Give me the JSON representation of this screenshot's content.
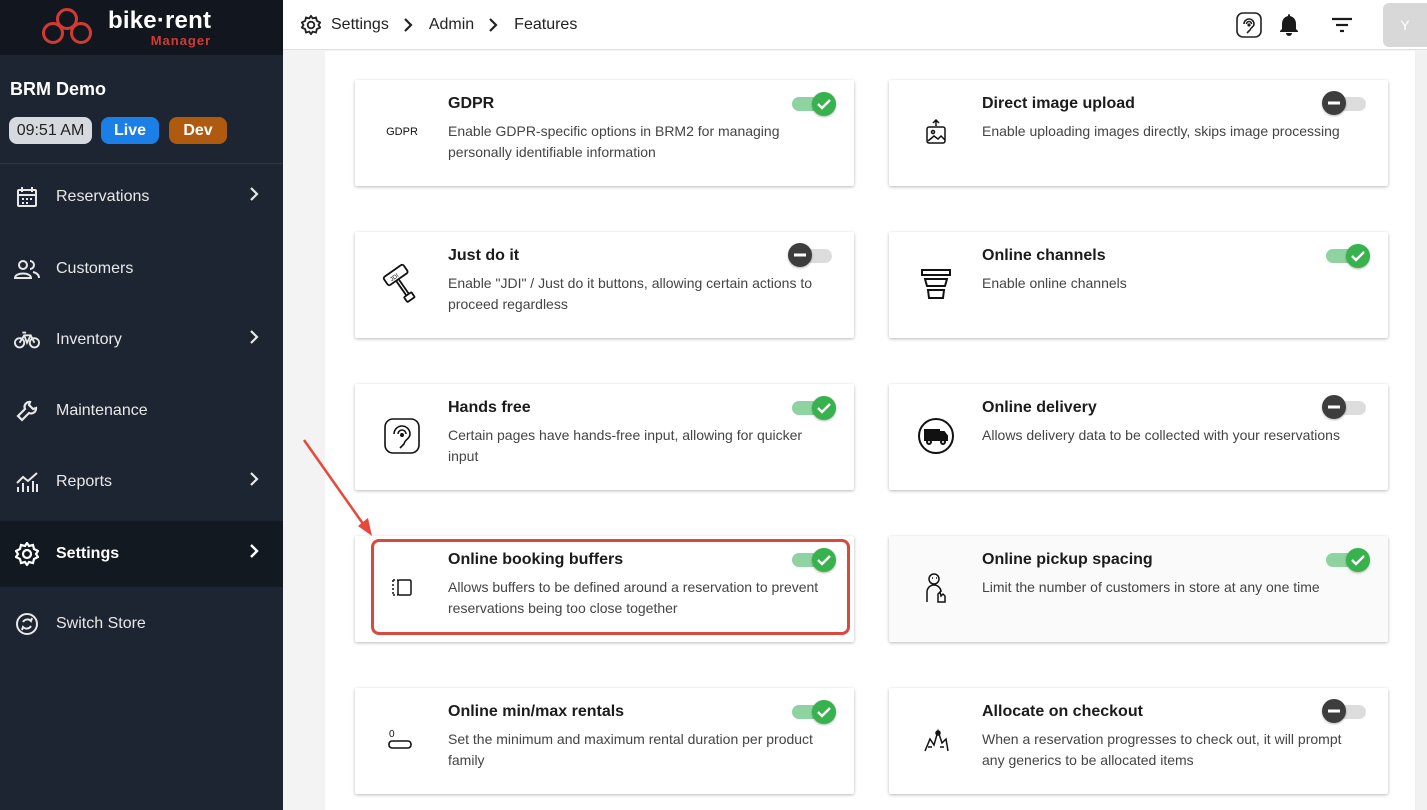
{
  "brand": {
    "name": "bike·rent",
    "sub": "Manager"
  },
  "store": {
    "name": "BRM Demo",
    "time": "09:51 AM",
    "live": "Live",
    "dev": "Dev"
  },
  "nav": [
    {
      "label": "Reservations",
      "icon": "calendar-icon",
      "chevron": true
    },
    {
      "label": "Customers",
      "icon": "people-icon",
      "chevron": false
    },
    {
      "label": "Inventory",
      "icon": "bike-icon",
      "chevron": true
    },
    {
      "label": "Maintenance",
      "icon": "wrench-icon",
      "chevron": false
    },
    {
      "label": "Reports",
      "icon": "chart-icon",
      "chevron": true
    },
    {
      "label": "Settings",
      "icon": "gear-icon",
      "chevron": true,
      "active": true
    },
    {
      "label": "Switch Store",
      "icon": "switch-icon",
      "chevron": false
    }
  ],
  "breadcrumb": [
    "Settings",
    "Admin",
    "Features"
  ],
  "header": {
    "avatar": "Y"
  },
  "features": [
    {
      "title": "GDPR",
      "desc": "Enable GDPR-specific options in BRM2 for managing personally identifiable information",
      "enabled": true,
      "icon_text": "GDPR",
      "icon": "gdpr-icon"
    },
    {
      "title": "Direct image upload",
      "desc": "Enable uploading images directly, skips image processing",
      "enabled": false,
      "icon": "image-upload-icon"
    },
    {
      "title": "Just do it",
      "desc": "Enable \"JDI\" / Just do it buttons, allowing certain actions to proceed regardless",
      "enabled": false,
      "icon": "stamp-icon"
    },
    {
      "title": "Online channels",
      "desc": "Enable online channels",
      "enabled": true,
      "icon": "channels-icon"
    },
    {
      "title": "Hands free",
      "desc": "Certain pages have hands-free input, allowing for quicker input",
      "enabled": true,
      "icon": "hands-free-icon"
    },
    {
      "title": "Online delivery",
      "desc": "Allows delivery data to be collected with your reservations",
      "enabled": false,
      "icon": "delivery-truck-icon"
    },
    {
      "title": "Online booking buffers",
      "desc": "Allows buffers to be defined around a reservation to prevent reservations being too close together",
      "enabled": true,
      "icon": "buffer-icon"
    },
    {
      "title": "Online pickup spacing",
      "desc": "Limit the number of customers in store at any one time",
      "enabled": true,
      "icon": "pickup-spacing-icon"
    },
    {
      "title": "Online min/max rentals",
      "desc": "Set the minimum and maximum rental duration per product family",
      "enabled": true,
      "icon": "min-max-icon",
      "icon_text": "0"
    },
    {
      "title": "Allocate on checkout",
      "desc": "When a reservation progresses to check out, it will prompt any generics to be allocated items",
      "enabled": false,
      "icon": "allocate-icon"
    }
  ],
  "colors": {
    "sidebar": "#1e2532",
    "accent_on": "#37b24d",
    "highlight": "#d9493e",
    "live": "#1a7fe6",
    "dev": "#b05a10"
  }
}
